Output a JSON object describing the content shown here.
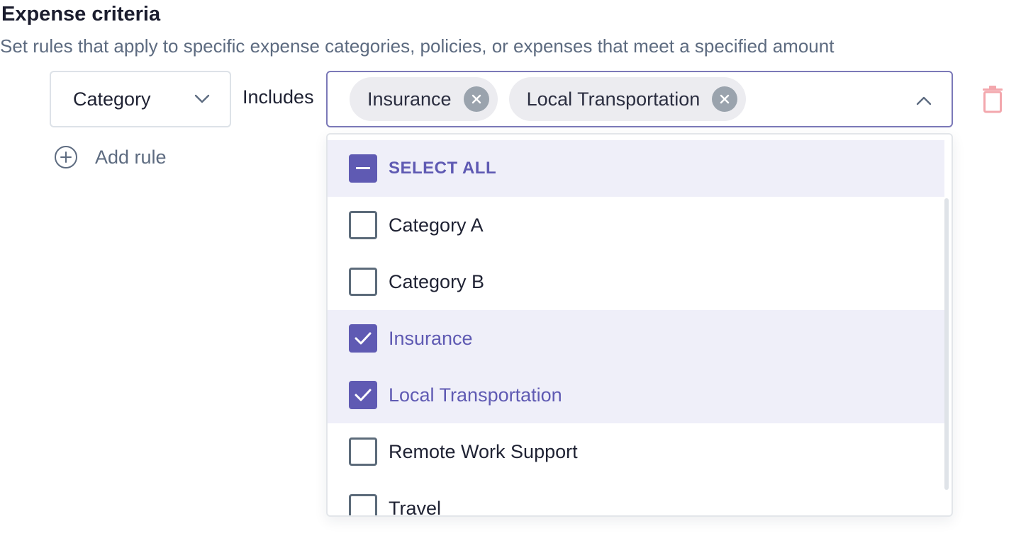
{
  "header": {
    "title": "Expense criteria",
    "subtitle": "Set rules that apply to specific expense categories, policies, or expenses that meet a specified amount"
  },
  "rule": {
    "field_select_value": "Category",
    "operator_label": "Includes",
    "chips": [
      {
        "label": "Insurance",
        "remove_icon": "close-circle-icon"
      },
      {
        "label": "Local Transportation",
        "remove_icon": "close-circle-icon"
      }
    ],
    "delete_icon": "trash-icon"
  },
  "add_rule": {
    "label": "Add rule",
    "icon": "plus-circle-icon"
  },
  "dropdown": {
    "select_all": {
      "label": "SELECT ALL",
      "state": "indeterminate"
    },
    "options": [
      {
        "label": "Category A",
        "checked": false
      },
      {
        "label": "Category B",
        "checked": false
      },
      {
        "label": "Insurance",
        "checked": true
      },
      {
        "label": "Local Transportation",
        "checked": true
      },
      {
        "label": "Remote Work Support",
        "checked": false
      },
      {
        "label": "Travel",
        "checked": false
      }
    ]
  },
  "colors": {
    "accent": "#5f5ab3",
    "highlight_bg": "#efeff9",
    "muted_text": "#5d6b80",
    "delete": "#f3a7ad"
  }
}
